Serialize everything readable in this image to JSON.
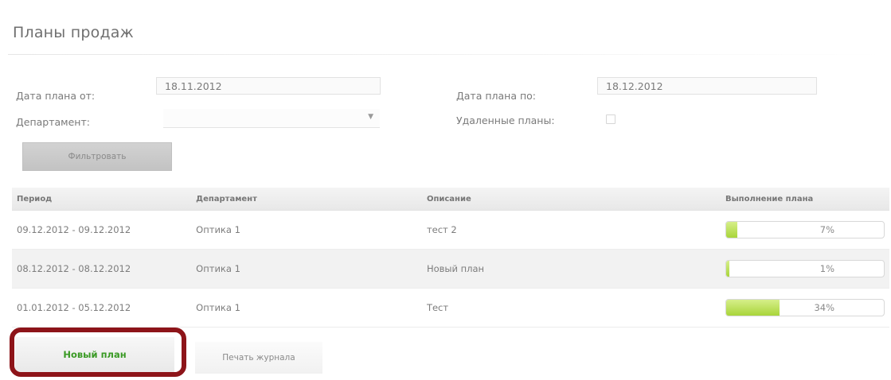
{
  "page": {
    "title": "Планы продаж"
  },
  "filters": {
    "date_from_label": "Дата плана от:",
    "date_from_value": "18.11.2012",
    "date_to_label": "Дата плана по:",
    "date_to_value": "18.12.2012",
    "department_label": "Департамент:",
    "department_value": "",
    "deleted_label": "Удаленные планы:",
    "deleted_checked": false,
    "filter_button": "Фильтровать"
  },
  "table": {
    "headers": {
      "period": "Период",
      "department": "Департамент",
      "description": "Описание",
      "completion": "Выполнение плана"
    },
    "rows": [
      {
        "period": "09.12.2012 - 09.12.2012",
        "department": "Оптика 1",
        "description": "тест 2",
        "completion": "7%",
        "completion_value": 7
      },
      {
        "period": "08.12.2012 - 08.12.2012",
        "department": "Оптика 1",
        "description": "Новый план",
        "completion": "1%",
        "completion_value": 1
      },
      {
        "period": "01.01.2012 - 05.12.2012",
        "department": "Оптика 1",
        "description": "Тест",
        "completion": "34%",
        "completion_value": 34
      }
    ]
  },
  "actions": {
    "new_plan": "Новый план",
    "print_journal": "Печать журнала"
  },
  "colors": {
    "highlight_ring": "#8d1419",
    "new_plan_text": "#3a9a25",
    "progress_fill": "#a9d53a"
  }
}
